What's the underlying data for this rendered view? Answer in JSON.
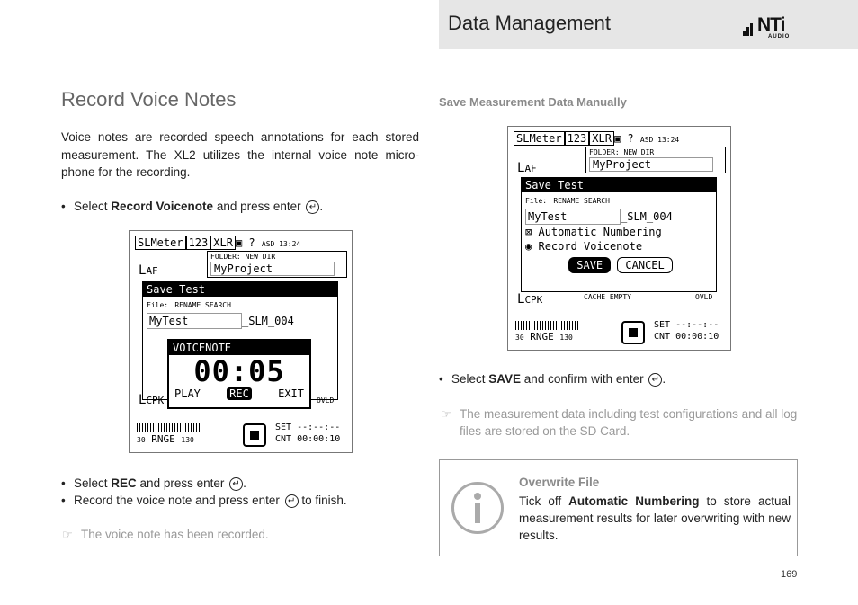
{
  "header": {
    "title": "Data Management",
    "logo_text": "NTi",
    "logo_sub": "AUDIO"
  },
  "left": {
    "heading": "Record Voice Notes",
    "paragraph": "Voice notes are recorded speech annotations for each stored measurement. The XL2 utilizes the internal voice note micro-phone for the recording.",
    "bullet1": {
      "pre": "Select ",
      "bold": "Record Voicenote",
      "post": " and press enter"
    },
    "bullet2": {
      "pre": "Select ",
      "bold": "REC",
      "post": " and press enter"
    },
    "bullet3": {
      "pre": "Record the voice note and press enter",
      "post": " to finish."
    },
    "note": "The voice note has been recorded."
  },
  "right": {
    "subheading": "Save Measurement Data Manually",
    "bullet1": {
      "pre": "Select ",
      "bold": "SAVE",
      "post": " and confirm with enter"
    },
    "note": "The measurement data including test configurations and all log files are stored on the SD Card."
  },
  "screen": {
    "top_bar": "SLMeter",
    "top_box1": "123",
    "top_box2": "XLR",
    "top_icons": "▣ ?",
    "asd": "ASD 13:24",
    "laf": "L",
    "laf_sub": "AF",
    "folder_label": "FOLDER: NEW DIR",
    "folder_value": "MyProject",
    "dialog_title": "Save Test",
    "file_label": "File:",
    "file_actions": "RENAME SEARCH",
    "file_value": "MyTest",
    "file_suffix": "_SLM_004",
    "auto_numbering": "Automatic Numbering",
    "record_voicenote": "Record Voicenote",
    "save_btn": "SAVE",
    "cancel_btn": "CANCEL",
    "cache_empty": "CACHE EMPTY",
    "ovld": "OVLD",
    "lcpk": "L",
    "lcpk_sub": "CPK",
    "range_low": "30",
    "range_label": "RNGE",
    "range_high": "130",
    "set_line": "SET --:--:--",
    "cnt_line": "CNT 00:00:10"
  },
  "voice": {
    "title": "VOICENOTE",
    "time": "00:05",
    "play": "PLAY",
    "rec": "REC",
    "exit": "EXIT"
  },
  "info": {
    "title": "Overwrite File",
    "pre": "Tick off ",
    "bold": "Automatic Numbering",
    "post": " to store actual measurement results for later overwriting with new results."
  },
  "page_number": "169"
}
